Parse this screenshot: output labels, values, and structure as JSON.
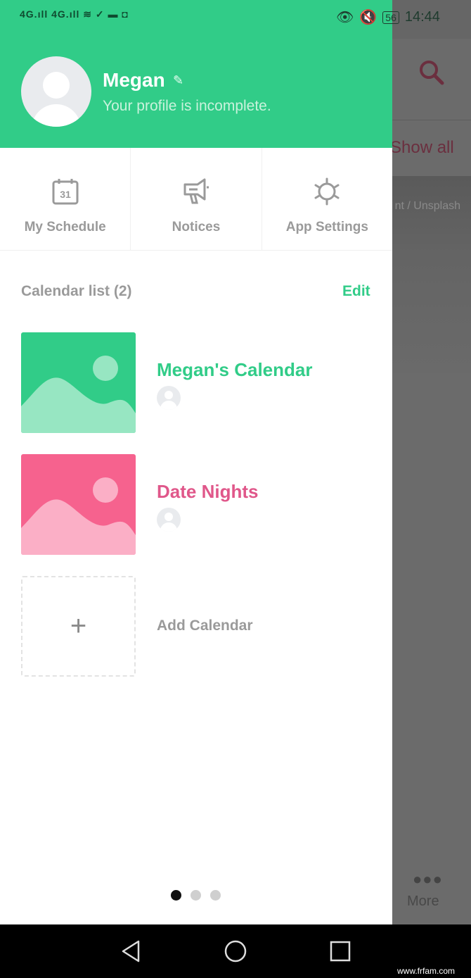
{
  "status_bar": {
    "left": "4G.ıll 4G.ıll ≋ ✓ ▬ ◘",
    "battery": "56",
    "time": "14:44"
  },
  "background_app": {
    "show_all": "Show all",
    "photo_credit": "nt / Unsplash",
    "more_label": "More"
  },
  "drawer": {
    "profile": {
      "name": "Megan",
      "subtitle": "Your profile is incomplete."
    },
    "quick_actions": [
      {
        "label": "My Schedule",
        "icon": "calendar-icon",
        "day": "31"
      },
      {
        "label": "Notices",
        "icon": "megaphone-icon"
      },
      {
        "label": "App Settings",
        "icon": "gear-icon"
      }
    ],
    "calendar_list": {
      "title": "Calendar list (2)",
      "edit": "Edit",
      "items": [
        {
          "name": "Megan's Calendar",
          "color": "#31cc88",
          "light": "#97e6c2"
        },
        {
          "name": "Date Nights",
          "color": "#f6628e",
          "light": "#fbafc6",
          "text_color": "#e0578a"
        }
      ],
      "add_label": "Add Calendar",
      "add_icon": "+"
    },
    "page_indicator": {
      "count": 3,
      "active": 0
    }
  },
  "accent_color": "#31cc88",
  "watermark": "www.frfam.com"
}
